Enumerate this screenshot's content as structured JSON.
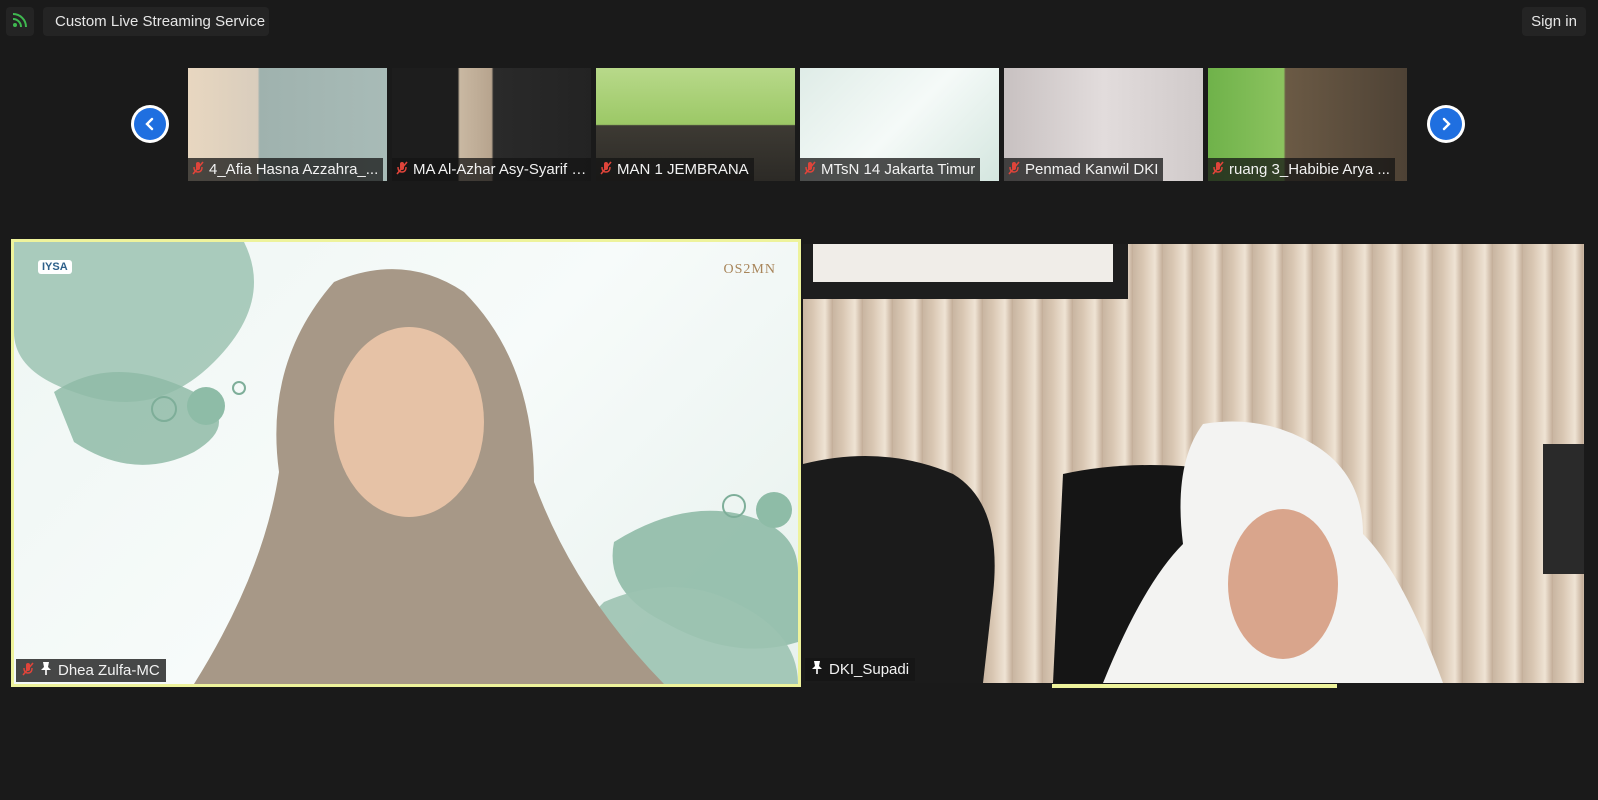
{
  "topbar": {
    "stream_label": "Custom Live Streaming Service",
    "signin_label": "Sign in"
  },
  "thumbnails": [
    {
      "name": "4_Afia Hasna Azzahra_...",
      "muted": true
    },
    {
      "name": "MA Al-Azhar Asy-Syarif KI...",
      "muted": true
    },
    {
      "name": "MAN 1 JEMBRANA",
      "muted": true
    },
    {
      "name": "MTsN 14 Jakarta Timur",
      "muted": true
    },
    {
      "name": "Penmad Kanwil DKI",
      "muted": true
    },
    {
      "name": "ruang 3_Habibie Arya ...",
      "muted": true
    }
  ],
  "main": {
    "left": {
      "name": "Dhea Zulfa-MC",
      "muted": true,
      "pinned": true,
      "logo_text": "OS2MN",
      "badge_text": "IYSA"
    },
    "right": {
      "name": "DKI_Supadi",
      "muted": false,
      "pinned": true
    }
  },
  "colors": {
    "background": "#1a1a1a",
    "active_speaker": "#eef39c",
    "nav_button": "#1f6fe0",
    "muted_icon": "#e0443a"
  }
}
